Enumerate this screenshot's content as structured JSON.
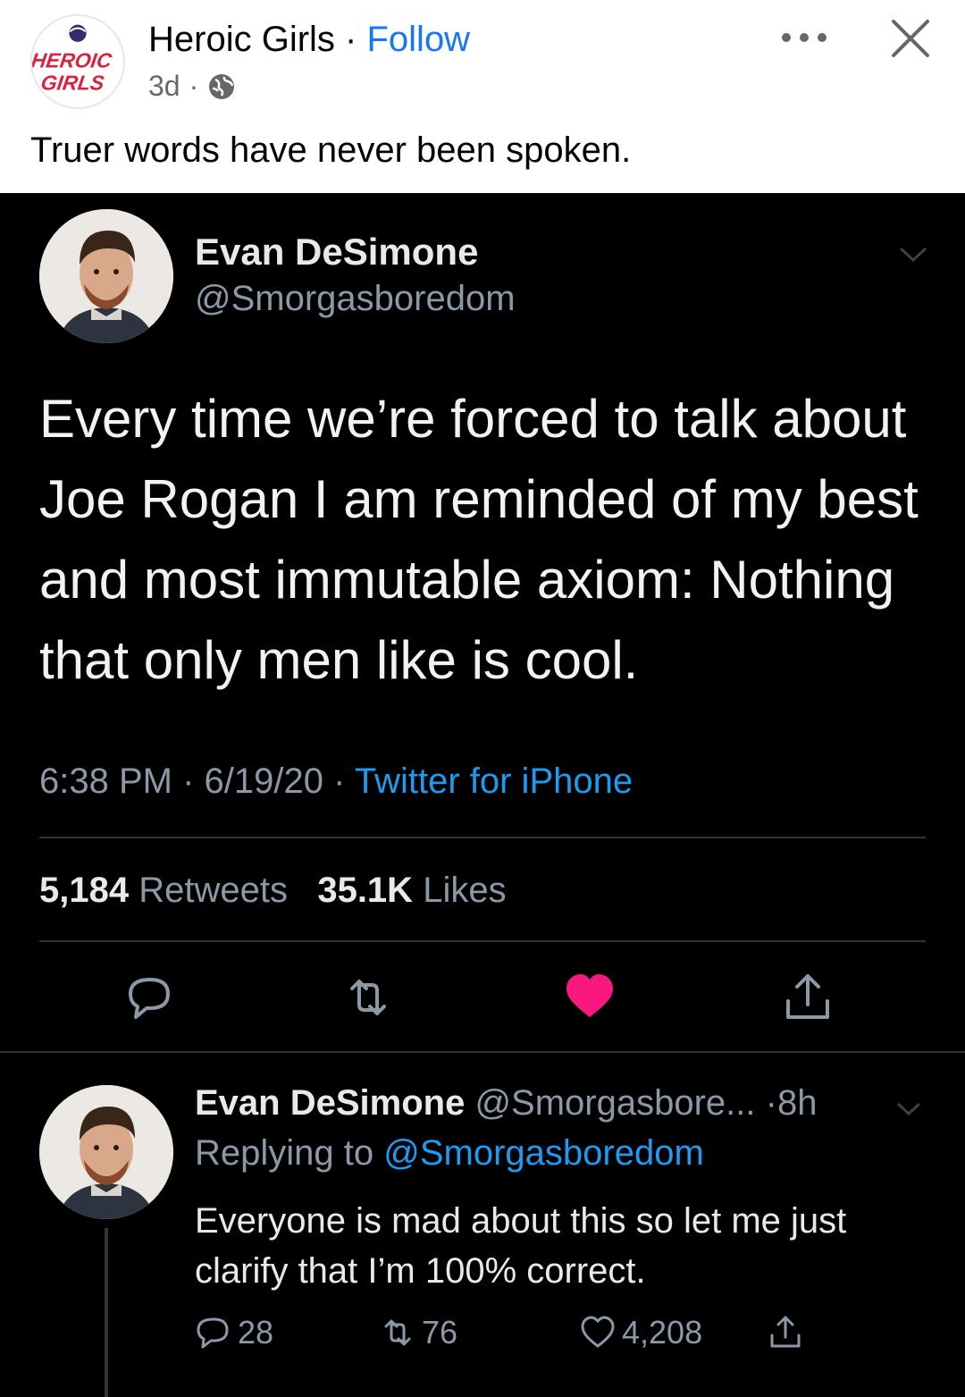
{
  "post": {
    "page_name": "Heroic Girls",
    "separator": "·",
    "follow_label": "Follow",
    "time": "3d",
    "meta_separator": "·",
    "caption": "Truer words have never been spoken.",
    "avatar_logo_text": "HEROIC GIRLS"
  },
  "tweet": {
    "author_name": "Evan DeSimone",
    "author_handle": "@Smorgasboredom",
    "text": "Every time we’re forced to talk about Joe Rogan I am reminded of my best and most immutable axiom: Nothing that only men like is cool.",
    "time": "6:38 PM",
    "date": "6/19/20",
    "meta_sep": "·",
    "source": "Twitter for iPhone",
    "retweets_count": "5,184",
    "retweets_label": "Retweets",
    "likes_count": "35.1K",
    "likes_label": "Likes",
    "accent_color": "#1d9bf0",
    "like_color": "#f91880"
  },
  "reply": {
    "author_name": "Evan DeSimone",
    "author_handle": "@Smorgasbore...",
    "time_sep": "·",
    "time": "8h",
    "replying_label": "Replying to",
    "replying_handle": "@Smorgasboredom",
    "text": "Everyone is mad about this so let me just clarify that I’m 100% correct.",
    "replies": "28",
    "retweets": "76",
    "likes": "4,208"
  }
}
